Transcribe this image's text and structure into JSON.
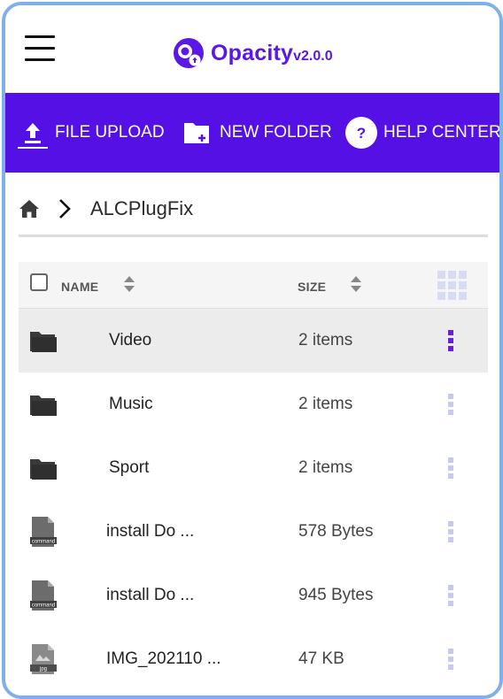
{
  "header": {
    "brand_name": "Opacity",
    "brand_version": "v2.0.0"
  },
  "toolbar": {
    "upload_label": "FILE UPLOAD",
    "new_folder_label": "NEW FOLDER",
    "help_label": "HELP CENTER",
    "help_glyph": "?"
  },
  "breadcrumb": {
    "current": "ALCPlugFix"
  },
  "table": {
    "col_name": "NAME",
    "col_size": "SIZE",
    "rows": [
      {
        "type": "folder",
        "name": "Video",
        "size": "2 items",
        "selected": true
      },
      {
        "type": "folder",
        "name": "Music",
        "size": "2 items",
        "selected": false
      },
      {
        "type": "folder",
        "name": "Sport",
        "size": "2 items",
        "selected": false
      },
      {
        "type": "command",
        "name": "install Do ...",
        "size": "578 Bytes",
        "icon_tag": "command",
        "selected": false
      },
      {
        "type": "command",
        "name": "install Do ...",
        "size": "945 Bytes",
        "icon_tag": "command",
        "selected": false
      },
      {
        "type": "image",
        "name": "IMG_202110 ...",
        "size": "47 KB",
        "icon_tag": "jpg",
        "selected": false
      }
    ]
  },
  "colors": {
    "brand": "#5b17e6",
    "toolbar_bg": "#5510e6",
    "kebab_active": "#6a1de0",
    "kebab_inactive": "#c7c9ef"
  }
}
